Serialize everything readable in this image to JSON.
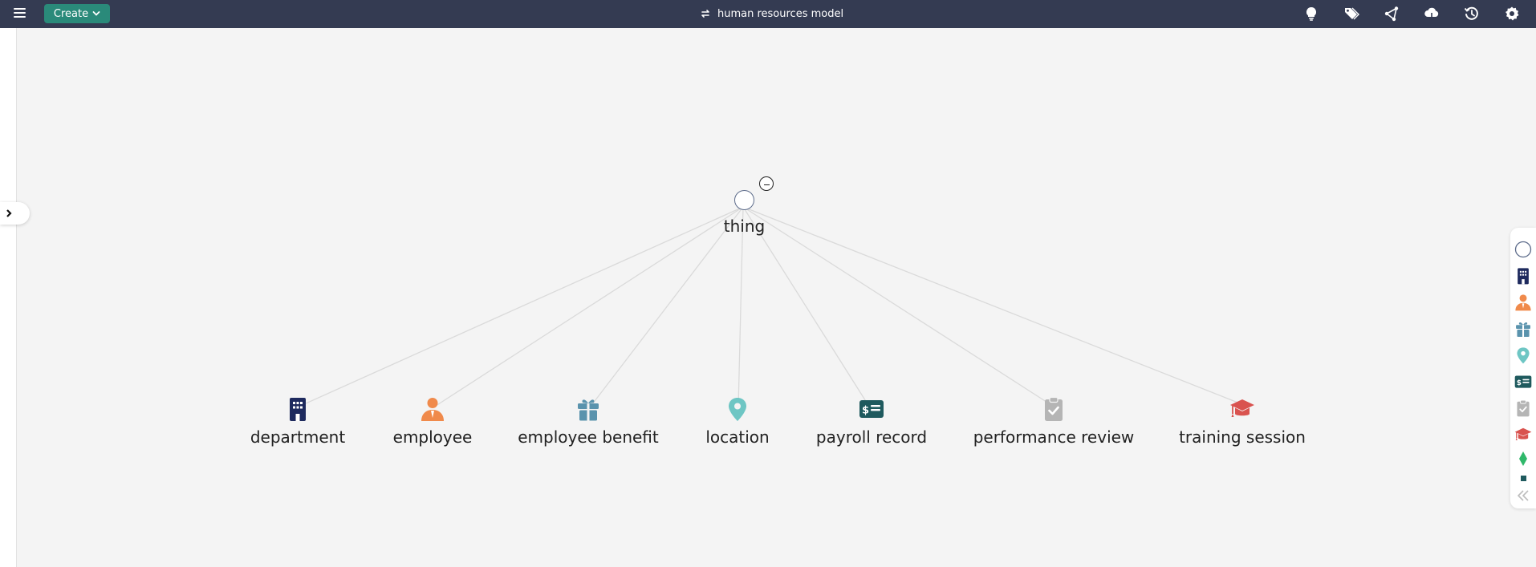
{
  "header": {
    "create_label": "Create",
    "model_title": "human resources model",
    "icons": [
      "lightbulb-icon",
      "tags-icon",
      "share-icon",
      "cloud-sync-icon",
      "history-icon",
      "settings-icon"
    ]
  },
  "graph": {
    "root": {
      "label": "thing",
      "collapse_symbol": "-"
    },
    "children": [
      {
        "label": "department",
        "icon": "building-icon",
        "color": "#1e2a5e"
      },
      {
        "label": "employee",
        "icon": "person-icon",
        "color": "#f08a4b"
      },
      {
        "label": "employee benefit",
        "icon": "gift-icon",
        "color": "#5a93ad"
      },
      {
        "label": "location",
        "icon": "map-pin-icon",
        "color": "#6ec6c4"
      },
      {
        "label": "payroll record",
        "icon": "money-check-icon",
        "color": "#1f5a5e"
      },
      {
        "label": "performance review",
        "icon": "clipboard-check-icon",
        "color": "#b5b5b5"
      },
      {
        "label": "training session",
        "icon": "graduation-cap-icon",
        "color": "#d9534f"
      }
    ]
  },
  "legend": {
    "items": [
      "circle-icon",
      "building-icon",
      "person-icon",
      "gift-icon",
      "map-pin-icon",
      "money-check-icon",
      "clipboard-check-icon",
      "graduation-cap-icon",
      "diamond-icon",
      "square-icon",
      "double-chevron-left-icon"
    ]
  }
}
